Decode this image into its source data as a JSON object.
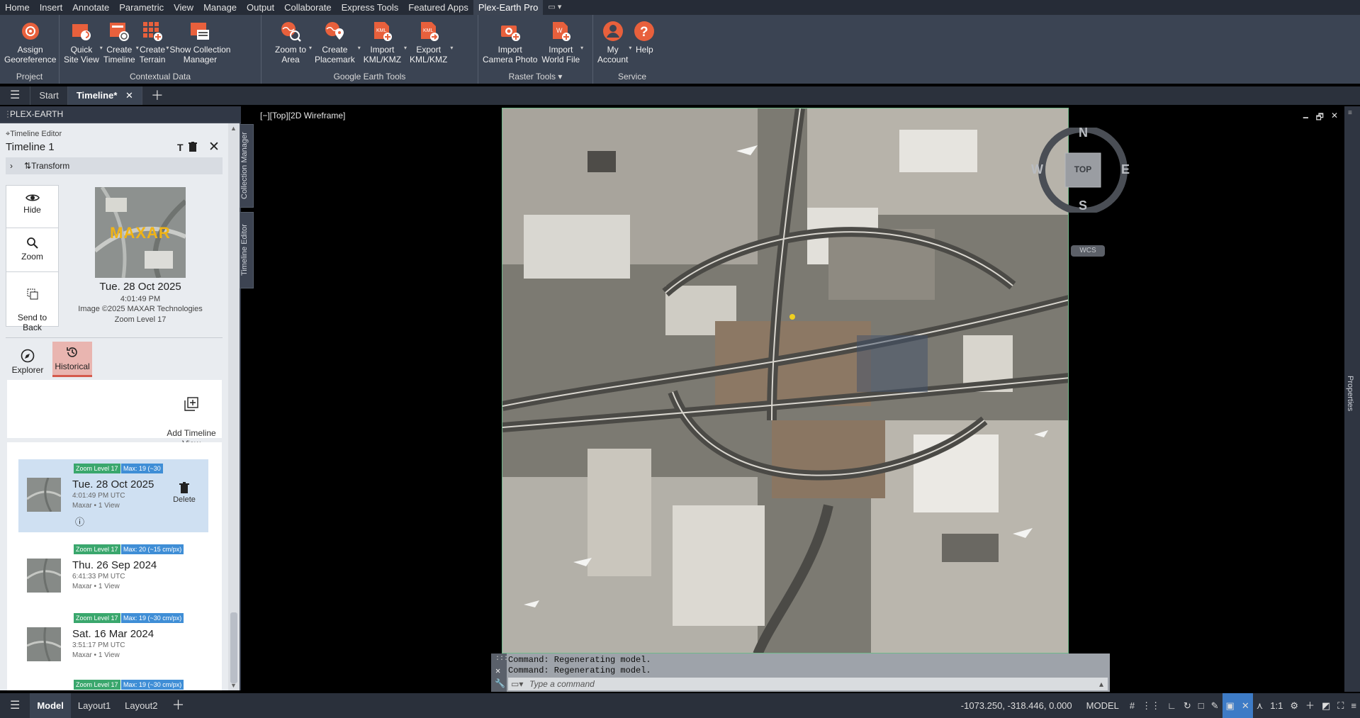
{
  "menu": {
    "items": [
      "Home",
      "Insert",
      "Annotate",
      "Parametric",
      "View",
      "Manage",
      "Output",
      "Collaborate",
      "Express Tools",
      "Featured Apps",
      "Plex-Earth Pro"
    ],
    "active": "Plex-Earth Pro"
  },
  "ribbon": {
    "panels": [
      {
        "title": "Project",
        "buttons": [
          {
            "label": "Assign\nGeoreference",
            "icon": "georeference-icon"
          }
        ]
      },
      {
        "title": "Contextual Data",
        "buttons": [
          {
            "label": "Quick\nSite View",
            "icon": "site-view-icon"
          },
          {
            "label": "Create\nTimeline",
            "icon": "timeline-icon"
          },
          {
            "label": "Create\nTerrain",
            "icon": "terrain-icon"
          },
          {
            "label": "Show Collection\nManager",
            "icon": "collection-icon"
          }
        ]
      },
      {
        "title": "Google Earth Tools",
        "buttons": [
          {
            "label": "Zoom to\nArea",
            "icon": "zoom-area-icon"
          },
          {
            "label": "Create\nPlacemark",
            "icon": "placemark-icon"
          },
          {
            "label": "Import\nKML/KMZ",
            "icon": "import-kml-icon"
          },
          {
            "label": "Export\nKML/KMZ",
            "icon": "export-kml-icon"
          }
        ]
      },
      {
        "title": "Raster Tools",
        "buttons": [
          {
            "label": "Import\nCamera Photo",
            "icon": "camera-photo-icon"
          },
          {
            "label": "Import\nWorld File",
            "icon": "world-file-icon"
          }
        ]
      },
      {
        "title": "Service",
        "buttons": [
          {
            "label": "My\nAccount",
            "icon": "account-icon"
          },
          {
            "label": "Help",
            "icon": "help-icon"
          }
        ]
      }
    ]
  },
  "tabs": {
    "start": "Start",
    "timeline": "Timeline*"
  },
  "palette": {
    "title": "PLEX-EARTH",
    "editor_label": "Timeline Editor",
    "timeline_name": "Timeline 1",
    "transform_label": "Transform",
    "actions": {
      "hide": "Hide",
      "zoom": "Zoom",
      "send_back": "Send to\nBack"
    },
    "preview": {
      "logo": "MAXAR",
      "date": "Tue. 28 Oct 2025",
      "time": "4:01:49 PM",
      "copyright": "Image ©2025 MAXAR Technologies",
      "zoom": "Zoom Level 17"
    },
    "modes": {
      "explorer": "Explorer",
      "historical": "Historical"
    },
    "add_view": "Add Timeline\nView",
    "items": [
      {
        "zoom": "Zoom Level 17",
        "max": "Max: 19 (~30",
        "date": "Tue. 28 Oct 2025",
        "time": "4:01:49 PM UTC",
        "meta": "Maxar • 1 View",
        "delete": "Delete",
        "selected": true
      },
      {
        "zoom": "Zoom Level 17",
        "max": "Max: 20 (~15 cm/px)",
        "date": "Thu. 26 Sep 2024",
        "time": "6:41:33 PM UTC",
        "meta": "Maxar • 1 View",
        "selected": false
      },
      {
        "zoom": "Zoom Level 17",
        "max": "Max: 19 (~30 cm/px)",
        "date": "Sat. 16 Mar 2024",
        "time": "3:51:17 PM UTC",
        "meta": "Maxar • 1 View",
        "selected": false
      },
      {
        "zoom": "Zoom Level 17",
        "max": "Max: 19 (~30 cm/px)",
        "date": "",
        "time": "",
        "meta": "",
        "selected": false
      }
    ],
    "side_tabs": [
      "Collection Manager",
      "Timeline Editor"
    ]
  },
  "viewport": {
    "label": "[−][Top][2D Wireframe]",
    "compass": {
      "n": "N",
      "s": "S",
      "e": "E",
      "w": "W",
      "top": "TOP",
      "wcs": "WCS"
    }
  },
  "command": {
    "history": [
      "Command: Regenerating model.",
      "Command: Regenerating model."
    ],
    "placeholder": "Type a command"
  },
  "right_tab": "Properties",
  "status": {
    "model": "Model",
    "layout1": "Layout1",
    "layout2": "Layout2",
    "coords": "-1073.250, -318.446, 0.000",
    "space": "MODEL",
    "scale": "1:1"
  },
  "colors": {
    "accent": "#e8603c",
    "ribbon_bg": "#3b4453",
    "menu_bg": "#262c37",
    "zoom_badge": "#3aa76d",
    "max_badge": "#3f8ed6",
    "selected": "#cfe0f2"
  }
}
